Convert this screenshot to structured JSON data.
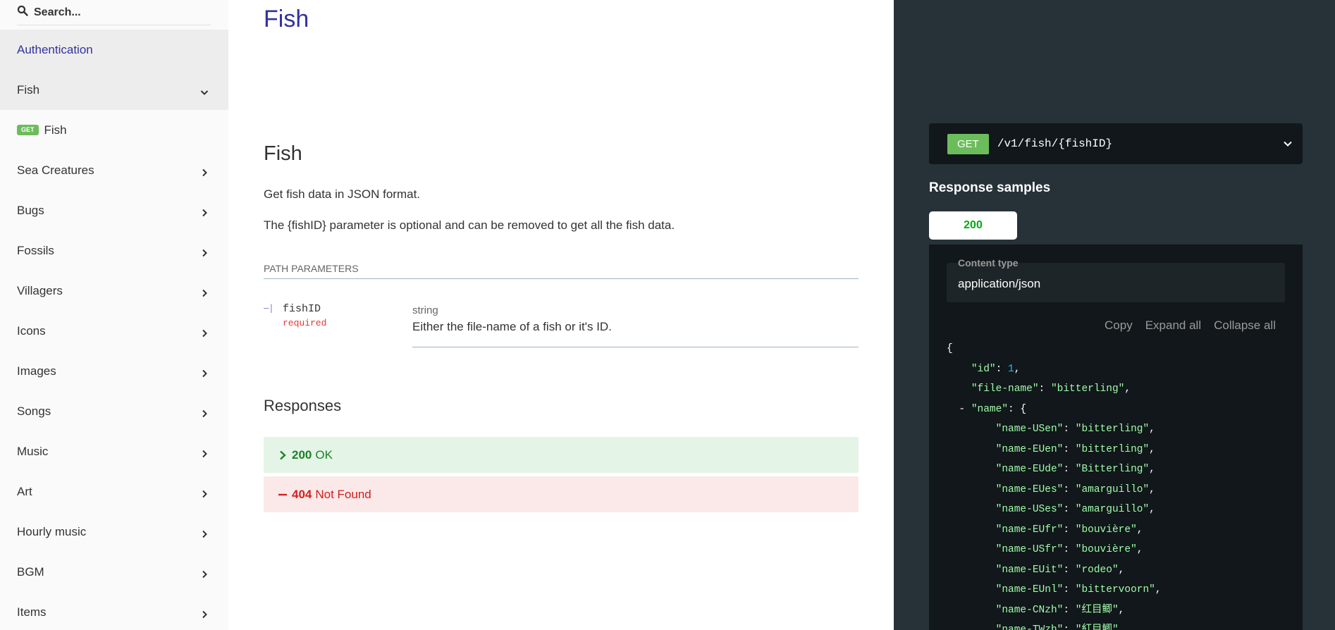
{
  "search": {
    "placeholder": "Search..."
  },
  "sidebar": {
    "items": [
      {
        "label": "Authentication"
      },
      {
        "label": "Fish"
      },
      {
        "label": "Fish",
        "badge": "GET"
      },
      {
        "label": "Sea Creatures"
      },
      {
        "label": "Bugs"
      },
      {
        "label": "Fossils"
      },
      {
        "label": "Villagers"
      },
      {
        "label": "Icons"
      },
      {
        "label": "Images"
      },
      {
        "label": "Songs"
      },
      {
        "label": "Music"
      },
      {
        "label": "Art"
      },
      {
        "label": "Hourly music"
      },
      {
        "label": "BGM"
      },
      {
        "label": "Items"
      }
    ]
  },
  "main": {
    "title": "Fish",
    "section_title": "Fish",
    "description1": "Get fish data in JSON format.",
    "description2": "The {fishID} parameter is optional and can be removed to get all the fish data.",
    "params_heading": "PATH PARAMETERS",
    "param": {
      "name": "fishID",
      "required": "required",
      "type": "string",
      "description": "Either the file-name of a fish or it's ID."
    },
    "responses_title": "Responses",
    "responses": [
      {
        "code": "200",
        "text": "OK"
      },
      {
        "code": "404",
        "text": "Not Found"
      }
    ]
  },
  "right_panel": {
    "method": "GET",
    "path": "/v1/fish/{fishID}",
    "samples_title": "Response samples",
    "tab": "200",
    "content_type_label": "Content type",
    "content_type_value": "application/json",
    "actions": {
      "copy": "Copy",
      "expand": "Expand all",
      "collapse": "Collapse all"
    },
    "json": {
      "id": "1",
      "file_name": "\"bitterling\"",
      "name_key": "\"name\"",
      "names": [
        {
          "key": "\"name-USen\"",
          "value": "\"bitterling\""
        },
        {
          "key": "\"name-EUen\"",
          "value": "\"bitterling\""
        },
        {
          "key": "\"name-EUde\"",
          "value": "\"Bitterling\""
        },
        {
          "key": "\"name-EUes\"",
          "value": "\"amarguillo\""
        },
        {
          "key": "\"name-USes\"",
          "value": "\"amarguillo\""
        },
        {
          "key": "\"name-EUfr\"",
          "value": "\"bouvière\""
        },
        {
          "key": "\"name-USfr\"",
          "value": "\"bouvière\""
        },
        {
          "key": "\"name-EUit\"",
          "value": "\"rodeo\""
        },
        {
          "key": "\"name-EUnl\"",
          "value": "\"bittervoorn\""
        },
        {
          "key": "\"name-CNzh\"",
          "value": "\"红目鲫\""
        },
        {
          "key": "\"name-TWzh\"",
          "value": "\"紅目鯽\""
        }
      ]
    }
  },
  "colors": {
    "accent": "#32329f",
    "get_badge": "#6bbd5b",
    "ok_bg": "#e4f4e6",
    "notfound_bg": "#fbe9e9",
    "panel_bg": "#263238",
    "code_bg": "#11171a"
  },
  "icons": {
    "search": "search-icon",
    "chevron_down": "chevron-down-icon",
    "chevron_right": "chevron-right-icon",
    "minus": "minus-icon"
  }
}
